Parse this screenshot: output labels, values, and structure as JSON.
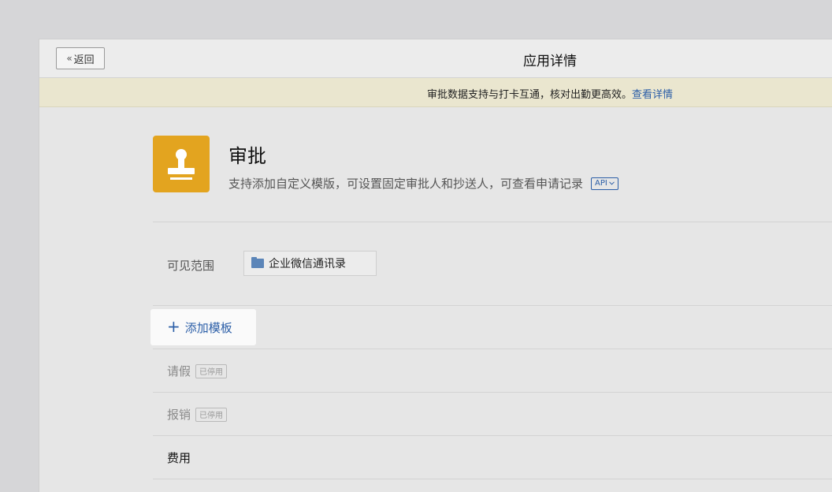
{
  "header": {
    "back_label": "返回",
    "title": "应用详情"
  },
  "notice": {
    "text": "审批数据支持与打卡互通，核对出勤更高效。",
    "link": "查看详情"
  },
  "app": {
    "name": "审批",
    "description": "支持添加自定义模版，可设置固定审批人和抄送人，可查看申请记录",
    "api_badge": "API",
    "icon_color": "#e3a41f",
    "icon": "stamp-icon"
  },
  "visibility": {
    "label": "可见范围",
    "value": "企业微信通讯录",
    "icon": "folder-icon"
  },
  "templates": {
    "add_label": "添加模板",
    "items": [
      {
        "name": "请假",
        "status": "已停用"
      },
      {
        "name": "报销",
        "status": "已停用"
      },
      {
        "name": "费用",
        "status": ""
      }
    ]
  },
  "colors": {
    "link": "#2b5ea7",
    "notice_bg": "#eae6cf",
    "panel_bg": "#e6e6e6"
  }
}
